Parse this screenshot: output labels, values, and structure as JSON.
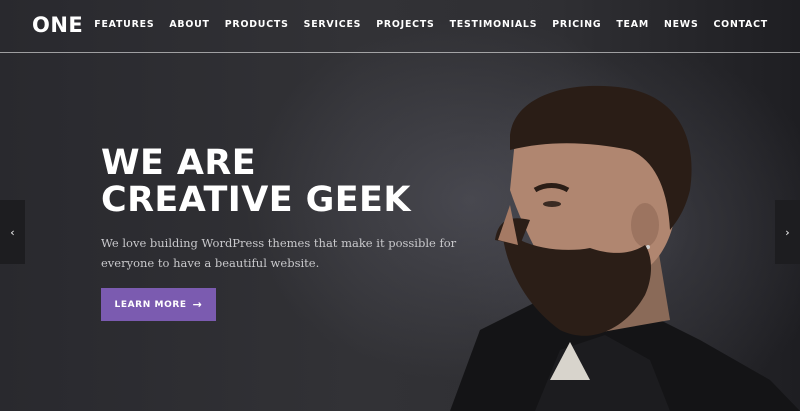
{
  "header": {
    "logo": "ONE",
    "nav": [
      "FEATURES",
      "ABOUT",
      "PRODUCTS",
      "SERVICES",
      "PROJECTS",
      "TESTIMONIALS",
      "PRICING",
      "TEAM",
      "NEWS",
      "CONTACT"
    ]
  },
  "hero": {
    "headline_line1": "WE ARE",
    "headline_line2": "CREATIVE GEEK",
    "subtext": "We love building WordPress themes that make it possible for everyone to have a beautiful website.",
    "cta_label": "LEARN MORE",
    "cta_icon": "arrow-right-icon",
    "cta_color": "#7b5bb0"
  },
  "slider": {
    "prev_icon": "chevron-left-icon",
    "next_icon": "chevron-right-icon"
  }
}
